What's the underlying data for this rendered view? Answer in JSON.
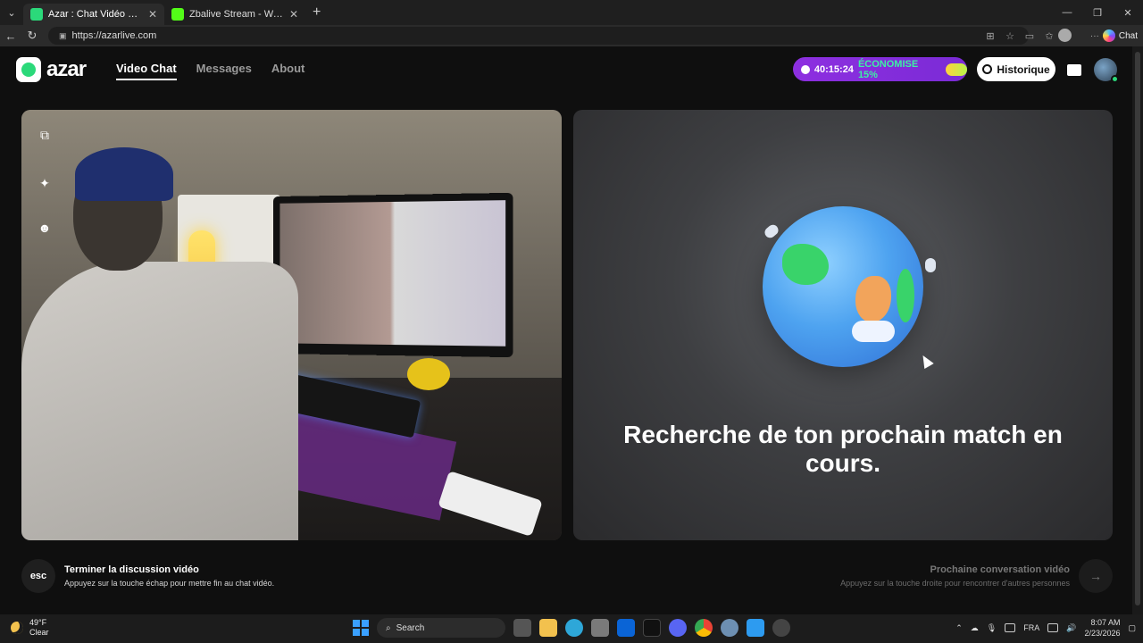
{
  "browser": {
    "tabs": [
      {
        "title": "Azar : Chat Vidéo avec de no",
        "close": "✕",
        "color": "#2bd97a",
        "active": true
      },
      {
        "title": "Zbalive Stream - Watch Live on Ki",
        "close": "✕",
        "color": "#53fc18",
        "active": false
      }
    ],
    "new_tab": "+",
    "url": "https://azarlive.com",
    "chat_label": "Chat"
  },
  "app": {
    "logo_text": "azar",
    "nav": [
      "Video Chat",
      "Messages",
      "About"
    ],
    "timer": "40:15:24",
    "promo": "ÉCONOMISE 15%",
    "history_label": "Historique",
    "accent": "#8d2fe0",
    "brand": "#2bd97a"
  },
  "match": {
    "searching_text": "Recherche de ton prochain match en cours."
  },
  "footer": {
    "esc_key": "esc",
    "end_title": "Terminer la discussion vidéo",
    "end_sub": "Appuyez sur la touche échap pour mettre fin au chat vidéo.",
    "next_title": "Prochaine conversation vidéo",
    "next_sub": "Appuyez sur la touche droite pour rencontrer d'autres personnes"
  },
  "taskbar": {
    "temp": "49°F",
    "condition": "Clear",
    "search_placeholder": "Search",
    "lang": "FRA",
    "time": "8:07 AM",
    "date": "2/23/2026"
  }
}
